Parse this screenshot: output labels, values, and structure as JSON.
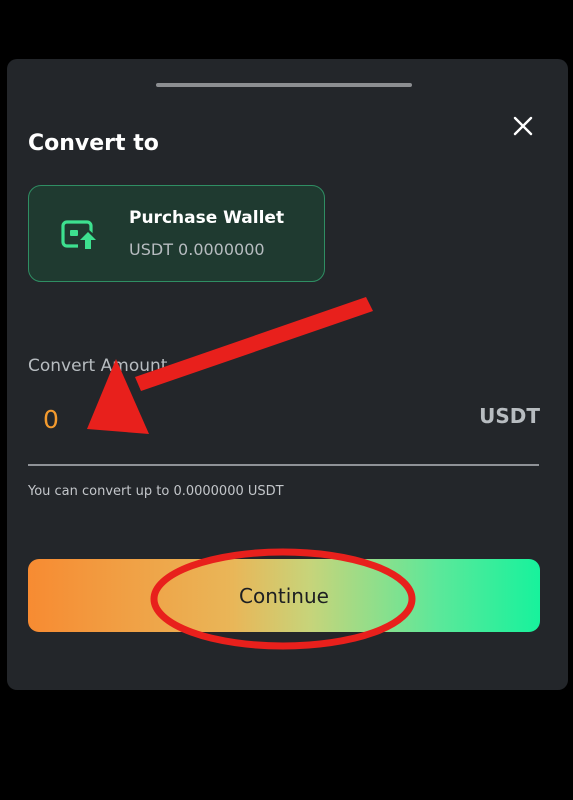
{
  "sheet": {
    "title": "Convert to",
    "close_icon": "close-icon"
  },
  "wallet": {
    "name": "Purchase Wallet",
    "balance": "USDT 0.0000000",
    "icon": "wallet-upload-icon",
    "accent_color": "#3de08f"
  },
  "amount": {
    "label": "Convert Amount",
    "value": "",
    "placeholder": "0",
    "currency": "USDT",
    "hint": "You can convert up to 0.0000000 USDT"
  },
  "actions": {
    "continue_label": "Continue"
  },
  "colors": {
    "background": "#23262a",
    "amount_text": "#f39a2e",
    "annotation": "#e8201c",
    "button_gradient_start": "#f78b32",
    "button_gradient_end": "#17f29c"
  }
}
